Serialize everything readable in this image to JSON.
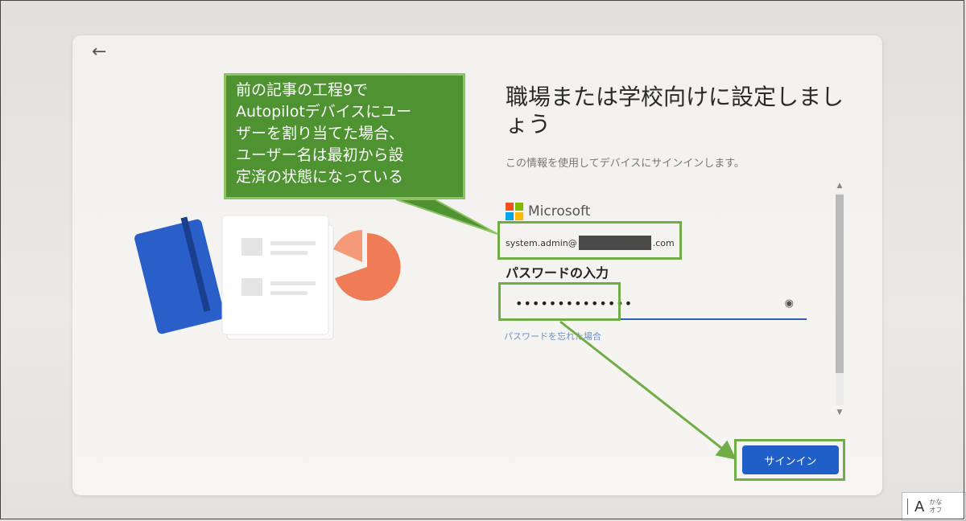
{
  "callout": {
    "lines": [
      "前の記事の工程9で",
      "Autopilotデバイスにユー",
      "ザーを割り当てた場合、",
      "ユーザー名は最初から設",
      "定済の状態になっている"
    ]
  },
  "header": {
    "back_icon": "←",
    "title_line1": "職場または学校向けに設定しまし",
    "title_line2": "ょう",
    "subtitle": "この情報を使用してデバイスにサインインします。"
  },
  "account": {
    "provider": "Microsoft",
    "logo_colors": [
      "#f25022",
      "#7fba00",
      "#00a4ef",
      "#ffb900"
    ],
    "username_prefix": "system.admin@",
    "username_suffix": ".com"
  },
  "password": {
    "label": "パスワードの入力",
    "value": "••••••••••••••",
    "reveal_icon": "◉",
    "forgot_link": "パスワードを忘れた場合"
  },
  "actions": {
    "signin_label": "サインイン"
  },
  "scrollbar": {
    "up": "▲",
    "down": "▼"
  },
  "ime": {
    "mode": "A",
    "line1": "かな",
    "line2": "オフ"
  },
  "colors": {
    "accent": "#1f5fc7",
    "annotation_green": "#70ad47",
    "callout_fill": "#4e9231"
  }
}
